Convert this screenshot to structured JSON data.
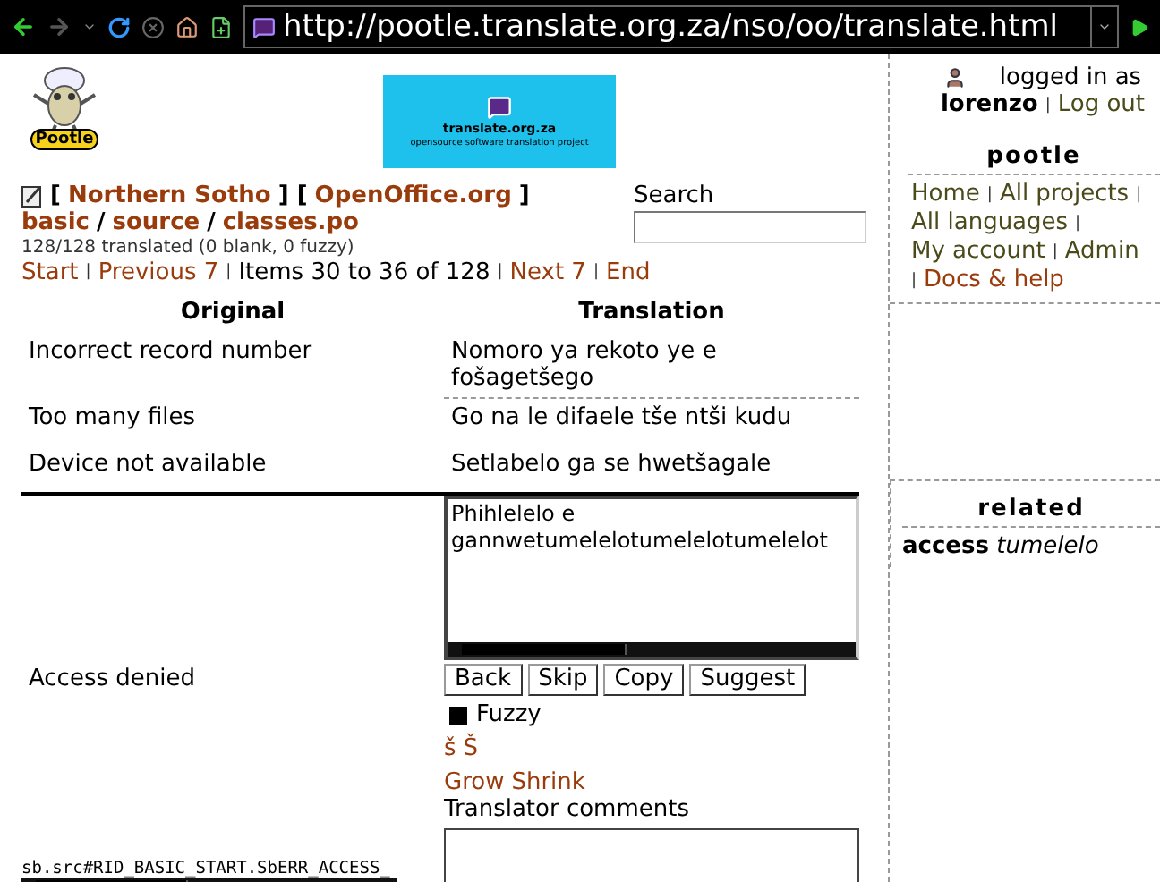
{
  "browser": {
    "url": "http://pootle.translate.org.za/nso/oo/translate.html"
  },
  "logo": {
    "label": "Pootle"
  },
  "banner": {
    "title": "translate.org.za",
    "subtitle": "opensource software translation project"
  },
  "project_line": [
    {
      "kind": "sep",
      "text": "["
    },
    {
      "kind": "link",
      "text": "Northern Sotho"
    },
    {
      "kind": "sep",
      "text": "] ["
    },
    {
      "kind": "link",
      "text": "OpenOffice.org"
    },
    {
      "kind": "sep",
      "text": "]"
    }
  ],
  "path_line": [
    {
      "kind": "link",
      "text": "basic"
    },
    {
      "kind": "sep",
      "text": "/"
    },
    {
      "kind": "link",
      "text": "source"
    },
    {
      "kind": "sep",
      "text": "/"
    },
    {
      "kind": "link",
      "text": "classes.po"
    }
  ],
  "stats": "128/128 translated (0 blank, 0 fuzzy)",
  "search": {
    "label": "Search"
  },
  "pager": [
    {
      "kind": "link",
      "text": "Start"
    },
    {
      "kind": "pipe",
      "text": "|"
    },
    {
      "kind": "link",
      "text": "Previous 7"
    },
    {
      "kind": "pipe",
      "text": "|"
    },
    {
      "kind": "text",
      "text": "Items 30 to 36 of 128"
    },
    {
      "kind": "pipe",
      "text": "|"
    },
    {
      "kind": "link",
      "text": "Next 7"
    },
    {
      "kind": "pipe",
      "text": "|"
    },
    {
      "kind": "link",
      "text": "End"
    }
  ],
  "table": {
    "columns": [
      "Original",
      "Translation"
    ],
    "rows": [
      {
        "original": "Incorrect record number",
        "translation": "Nomoro ya rekoto ye e fošagetšego"
      },
      {
        "original": "Too many files",
        "translation": "Go na le difaele tše ntši kudu"
      },
      {
        "original": "Device not available",
        "translation": "Setlabelo ga se hwetšagale"
      }
    ]
  },
  "editor": {
    "original": "Access denied",
    "value": "Phihlelelo e gannwetumelelotumelelotumelelot",
    "buttons": [
      "Back",
      "Skip",
      "Copy",
      "Suggest"
    ],
    "fuzzy": {
      "label": "Fuzzy",
      "checked": true
    },
    "special_chars": [
      "š",
      "Š"
    ],
    "resize": [
      "Grow",
      "Shrink"
    ],
    "comments_label": "Translator comments",
    "location": "sb.src#RID_BASIC_START.SbERR_ACCESS_"
  },
  "sidebar": {
    "user": {
      "prefix": "logged in as",
      "name": "lorenzo",
      "separator": "|",
      "logout": "Log out"
    },
    "title": "pootle",
    "links": [
      {
        "kind": "link",
        "text": "Home"
      },
      {
        "kind": "pipe",
        "text": "|"
      },
      {
        "kind": "link",
        "text": "All projects"
      },
      {
        "kind": "pipe",
        "text": "|"
      },
      {
        "kind": "link",
        "text": "All languages"
      },
      {
        "kind": "pipe",
        "text": "|"
      },
      {
        "kind": "link",
        "text": "My account"
      },
      {
        "kind": "pipe",
        "text": "|"
      },
      {
        "kind": "link",
        "text": "Admin"
      },
      {
        "kind": "pipe",
        "text": "|"
      },
      {
        "kind": "help",
        "text": "Docs & help"
      }
    ],
    "related": {
      "title": "related",
      "entries": [
        "**access** *tumelelo*"
      ]
    }
  }
}
